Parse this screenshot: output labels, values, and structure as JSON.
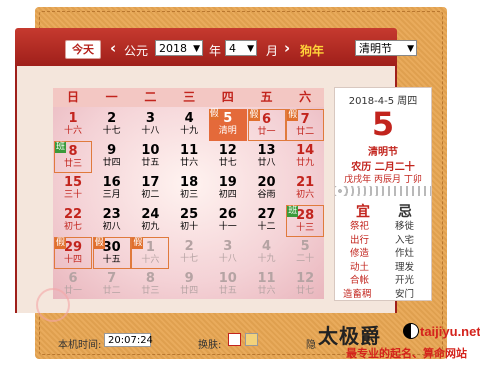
{
  "header": {
    "today_label": "今天",
    "prev_icon": "‹",
    "next_icon": "›",
    "era_label": "公元",
    "year_value": "2018",
    "year_label": "年",
    "month_value": "4",
    "month_label": "月",
    "zodiac_label": "狗年",
    "festival_select": "清明节"
  },
  "weekdays": [
    "日",
    "一",
    "二",
    "三",
    "四",
    "五",
    "六"
  ],
  "days": [
    {
      "d": "1",
      "l": "十六",
      "c": "red"
    },
    {
      "d": "2",
      "l": "十七"
    },
    {
      "d": "3",
      "l": "十八"
    },
    {
      "d": "4",
      "l": "十九"
    },
    {
      "d": "5",
      "l": "清明",
      "tag": "假",
      "sel": true
    },
    {
      "d": "6",
      "l": "廿一",
      "tag": "假",
      "hl": true,
      "c": "red"
    },
    {
      "d": "7",
      "l": "廿二",
      "tag": "假",
      "hl": true,
      "c": "red"
    },
    {
      "d": "8",
      "l": "廿三",
      "tag": "班",
      "tagb": true,
      "hl": true,
      "c": "red"
    },
    {
      "d": "9",
      "l": "廿四"
    },
    {
      "d": "10",
      "l": "廿五"
    },
    {
      "d": "11",
      "l": "廿六"
    },
    {
      "d": "12",
      "l": "廿七"
    },
    {
      "d": "13",
      "l": "廿八"
    },
    {
      "d": "14",
      "l": "廿九",
      "c": "red"
    },
    {
      "d": "15",
      "l": "三十",
      "c": "red"
    },
    {
      "d": "16",
      "l": "三月"
    },
    {
      "d": "17",
      "l": "初二"
    },
    {
      "d": "18",
      "l": "初三"
    },
    {
      "d": "19",
      "l": "初四"
    },
    {
      "d": "20",
      "l": "谷雨"
    },
    {
      "d": "21",
      "l": "初六",
      "c": "red"
    },
    {
      "d": "22",
      "l": "初七",
      "c": "red"
    },
    {
      "d": "23",
      "l": "初八"
    },
    {
      "d": "24",
      "l": "初九"
    },
    {
      "d": "25",
      "l": "初十"
    },
    {
      "d": "26",
      "l": "十一"
    },
    {
      "d": "27",
      "l": "十二"
    },
    {
      "d": "28",
      "l": "十三",
      "tag": "班",
      "tagb": true,
      "hl": true,
      "c": "red"
    },
    {
      "d": "29",
      "l": "十四",
      "tag": "假",
      "hl": true,
      "c": "red"
    },
    {
      "d": "30",
      "l": "十五",
      "tag": "假",
      "hl": true
    },
    {
      "d": "1",
      "l": "十六",
      "tag": "假",
      "hl": true,
      "o": true
    },
    {
      "d": "2",
      "l": "十七",
      "o": true
    },
    {
      "d": "3",
      "l": "十八",
      "o": true
    },
    {
      "d": "4",
      "l": "十九",
      "o": true
    },
    {
      "d": "5",
      "l": "二十",
      "o": true
    },
    {
      "d": "6",
      "l": "廿一",
      "o": true
    },
    {
      "d": "7",
      "l": "廿二",
      "o": true
    },
    {
      "d": "8",
      "l": "廿三",
      "o": true
    },
    {
      "d": "9",
      "l": "廿四",
      "o": true
    },
    {
      "d": "10",
      "l": "廿五",
      "o": true
    },
    {
      "d": "11",
      "l": "廿六",
      "o": true
    },
    {
      "d": "12",
      "l": "廿七",
      "o": true
    }
  ],
  "side": {
    "date_line": "2018-4-5  周四",
    "big_day": "5",
    "festival": "清明节",
    "lunar": "农历 二月二十",
    "ganzhi": "戊戌年 丙辰月 丁卯",
    "yi_label": "宜",
    "ji_label": "忌",
    "yi": [
      "祭祀",
      "出行",
      "修造",
      "动土",
      "合帐",
      "造畜稠"
    ],
    "ji": [
      "移徙",
      "入宅",
      "作灶",
      "理发",
      "开光",
      "安门"
    ]
  },
  "footer": {
    "time_label": "本机时间:",
    "time_value": "20:07:24",
    "skin_label": "换肤:",
    "extra_label": "隐"
  },
  "watermark": {
    "logo": "太极爵",
    "url": "taijiyu.net",
    "tagline": "最专业的起名、算命网站"
  },
  "colors": {
    "accent": "#c2241d",
    "frame": "#e8a652",
    "holiday": "#e0702e",
    "workday": "#3a9a3a"
  }
}
